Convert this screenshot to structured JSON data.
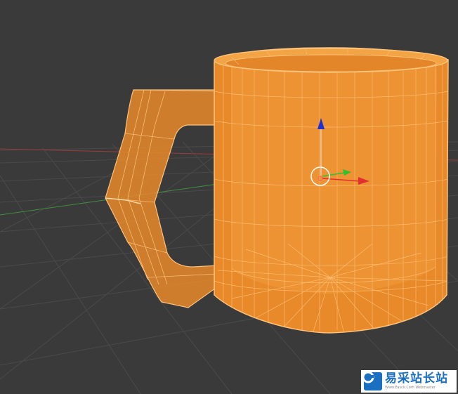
{
  "viewport": {
    "background": "#3a3a3a",
    "grid_color": "#4a4a4a",
    "x_axis_color": "#9c3b3b",
    "y_axis_color": "#3f8f3f"
  },
  "object": {
    "name": "mug",
    "fill_color": "#e88a2a",
    "wire_color": "#ffc27a",
    "selected": true
  },
  "gizmo": {
    "x_arrow_color": "#e03030",
    "y_arrow_color": "#30c030",
    "z_arrow_color": "#2030d0",
    "pivot_icon": "3d-cursor-icon"
  },
  "watermark": {
    "title": "易采站长站",
    "subtitle": "Www.Easck.Com Webmaster"
  }
}
